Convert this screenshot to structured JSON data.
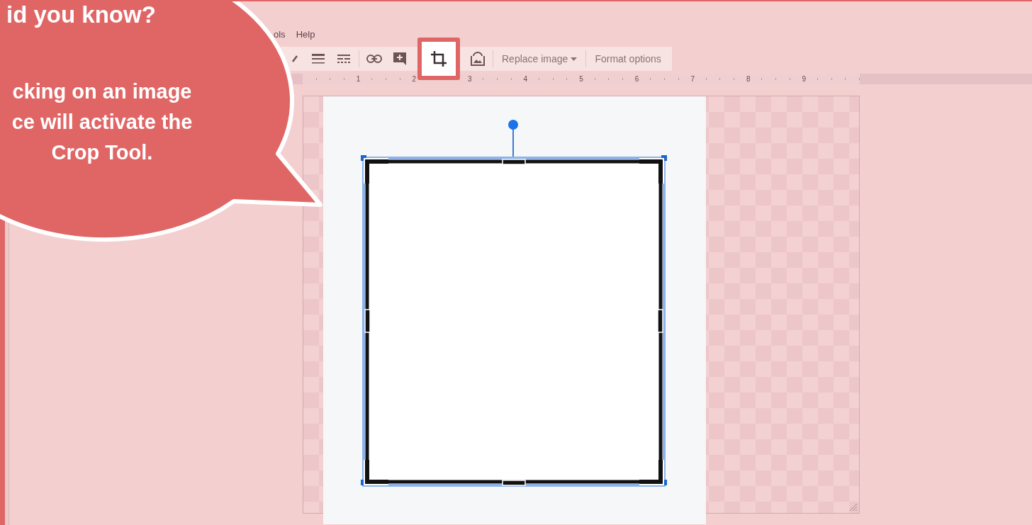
{
  "callout": {
    "title": "id you know?",
    "lines": [
      "cking on an image",
      "ce will activate the",
      "Crop Tool."
    ]
  },
  "menu": [
    "ols",
    "Help"
  ],
  "toolbar": {
    "crop": {
      "selected": true
    },
    "buttons": [
      {
        "label": "Replace image",
        "dropdown": true
      },
      {
        "label": "Format options",
        "dropdown": false
      }
    ]
  },
  "ruler": {
    "marks": [
      "1",
      "2",
      "3",
      "4",
      "5",
      "6",
      "7",
      "8",
      "9"
    ]
  }
}
